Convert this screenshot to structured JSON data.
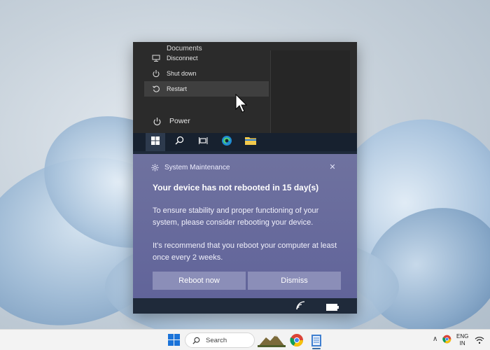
{
  "start_menu": {
    "documents_label": "Documents",
    "items": [
      {
        "label": "Disconnect",
        "icon": "disconnect-icon"
      },
      {
        "label": "Shut down",
        "icon": "power-icon"
      },
      {
        "label": "Restart",
        "icon": "restart-icon"
      }
    ],
    "power_label": "Power"
  },
  "notification": {
    "app_name": "System Maintenance",
    "close_glyph": "✕",
    "title": "Your device has not rebooted in 15 day(s)",
    "body_paragraph_1": "To ensure stability and proper functioning of your system, please consider rebooting your device.",
    "body_paragraph_2": "It's recommend that you reboot your computer at least once every 2 weeks.",
    "primary_button": "Reboot now",
    "secondary_button": "Dismiss",
    "accent_color": "#6a6d9f"
  },
  "taskbar": {
    "search_label": "Search",
    "language": "ENG",
    "region": "IN",
    "tray_chevron": "∧"
  }
}
